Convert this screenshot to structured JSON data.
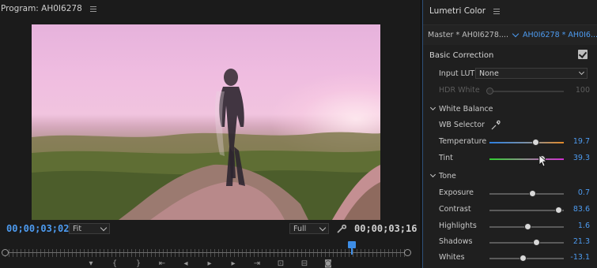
{
  "program": {
    "title": "Program: AH0I6278",
    "timecode_current": "00;00;03;02",
    "timecode_duration": "00;00;03;16",
    "fit_select": "Fit",
    "quality_select": "Full",
    "playhead_position": 0.86
  },
  "lumetri": {
    "title": "Lumetri Color",
    "tab_master": "Master * AH0I6278....",
    "tab_clip": "AH0I6278 * AH0I6...",
    "basic_correction": {
      "label": "Basic Correction",
      "enabled": true
    },
    "input_lut": {
      "label": "Input LUT",
      "value": "None"
    },
    "hdr_white": {
      "label": "HDR White",
      "value": "100",
      "position": 0.0
    },
    "white_balance": {
      "section_label": "White Balance",
      "wb_selector_label": "WB Selector",
      "temperature": {
        "label": "Temperature",
        "value": "19.7",
        "position": 0.62
      },
      "tint": {
        "label": "Tint",
        "value": "39.3",
        "position": 0.7
      }
    },
    "tone": {
      "section_label": "Tone",
      "exposure": {
        "label": "Exposure",
        "value": "0.7",
        "position": 0.57
      },
      "contrast": {
        "label": "Contrast",
        "value": "83.6",
        "position": 0.93
      },
      "highlights": {
        "label": "Highlights",
        "value": "1.6",
        "position": 0.51
      },
      "shadows": {
        "label": "Shadows",
        "value": "21.3",
        "position": 0.63
      },
      "whites": {
        "label": "Whites",
        "value": "-13.1",
        "position": 0.45
      }
    }
  },
  "colors": {
    "accent": "#4d9bf0",
    "panel_bg": "#1f1f1f"
  }
}
